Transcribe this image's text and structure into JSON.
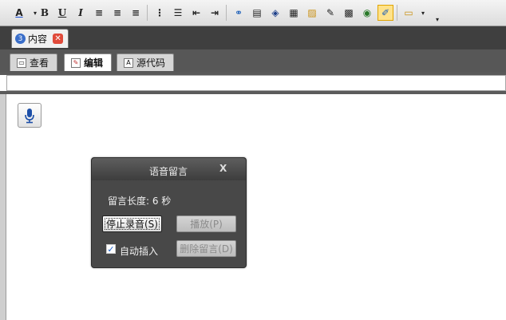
{
  "toolbar": {
    "items": [
      {
        "name": "font-color",
        "glyph": "A"
      },
      {
        "name": "bold",
        "glyph": "B"
      },
      {
        "name": "underline",
        "glyph": "U"
      },
      {
        "name": "italic",
        "glyph": "I"
      },
      {
        "name": "align-left",
        "glyph": "≡"
      },
      {
        "name": "align-center",
        "glyph": "≡"
      },
      {
        "name": "align-right",
        "glyph": "≡"
      },
      {
        "name": "ordered-list",
        "glyph": "⋮"
      },
      {
        "name": "bullet-list",
        "glyph": "☰"
      },
      {
        "name": "outdent",
        "glyph": "⇤"
      },
      {
        "name": "indent",
        "glyph": "⇥"
      },
      {
        "name": "link",
        "glyph": "⚭"
      },
      {
        "name": "document",
        "glyph": "▤"
      },
      {
        "name": "layers",
        "glyph": "◈"
      },
      {
        "name": "table",
        "glyph": "▦"
      },
      {
        "name": "image",
        "glyph": "▨"
      },
      {
        "name": "edit-image",
        "glyph": "✎"
      },
      {
        "name": "gallery",
        "glyph": "▩"
      },
      {
        "name": "camera",
        "glyph": "◉"
      },
      {
        "name": "voice",
        "glyph": "✐"
      },
      {
        "name": "template",
        "glyph": "▭"
      }
    ]
  },
  "doc_tab": {
    "number": "3",
    "label": "内容"
  },
  "view_tabs": [
    "查看",
    "编辑",
    "源代码"
  ],
  "dialog": {
    "title": "语音留言",
    "length_text": "留言长度: 6 秒",
    "stop_button": "停止录音(S)",
    "play_button": "播放(P)",
    "delete_button": "删除留言(D)",
    "auto_insert_label": "自动插入",
    "auto_insert_checked": true
  }
}
